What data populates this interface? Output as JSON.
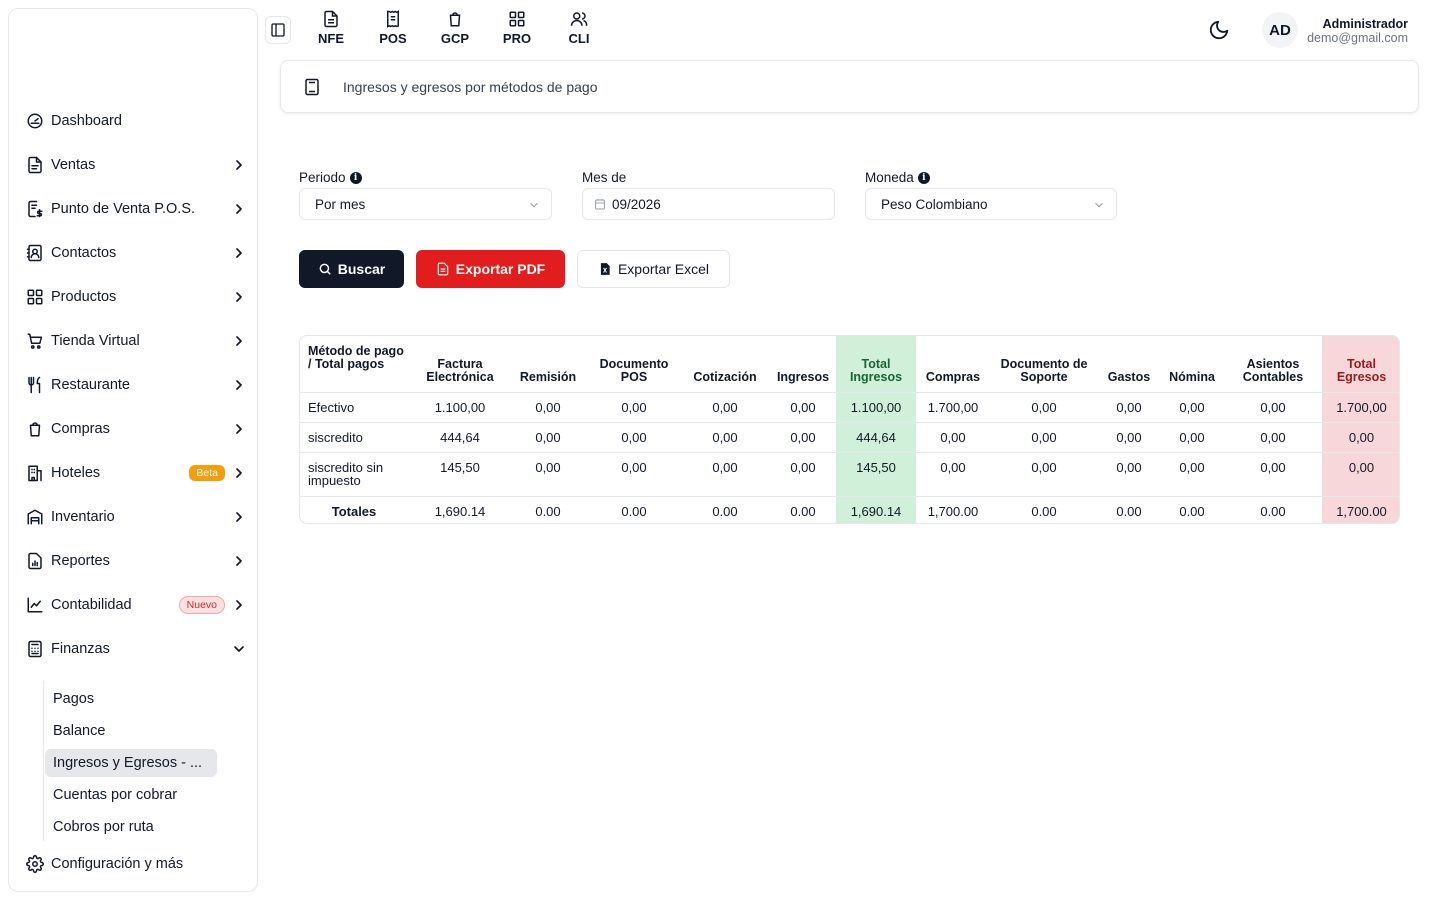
{
  "sidebar": {
    "items": [
      {
        "label": "Dashboard",
        "icon": "dashboard-icon",
        "chevron": false
      },
      {
        "label": "Ventas",
        "icon": "document-icon",
        "chevron": true
      },
      {
        "label": "Punto de Venta P.O.S.",
        "icon": "receipt-dollar-icon",
        "chevron": true
      },
      {
        "label": "Contactos",
        "icon": "contact-book-icon",
        "chevron": true
      },
      {
        "label": "Productos",
        "icon": "grid-icon",
        "chevron": true
      },
      {
        "label": "Tienda Virtual",
        "icon": "cart-icon",
        "chevron": true
      },
      {
        "label": "Restaurante",
        "icon": "utensils-icon",
        "chevron": true
      },
      {
        "label": "Compras",
        "icon": "shopping-bag-icon",
        "chevron": true
      },
      {
        "label": "Hoteles",
        "icon": "hotel-icon",
        "chevron": true,
        "badge": "Beta"
      },
      {
        "label": "Inventario",
        "icon": "warehouse-icon",
        "chevron": true
      },
      {
        "label": "Reportes",
        "icon": "report-icon",
        "chevron": true
      },
      {
        "label": "Contabilidad",
        "icon": "chart-icon",
        "chevron": true,
        "badge": "Nuevo"
      },
      {
        "label": "Finanzas",
        "icon": "calculator-icon",
        "chevron": "down"
      }
    ],
    "sub_items": [
      "Pagos",
      "Balance",
      "Ingresos y Egresos - ...",
      "Cuentas por cobrar",
      "Cobros por ruta"
    ],
    "active_sub": "Ingresos y Egresos - ...",
    "footer": "Configuración y más"
  },
  "topbar": {
    "modules": [
      "NFE",
      "POS",
      "GCP",
      "PRO",
      "CLI"
    ],
    "avatar": "AD",
    "user_name": "Administrador",
    "user_email": "demo@gmail.com"
  },
  "header": {
    "title": "Ingresos y egresos por métodos de pago"
  },
  "filters": {
    "periodo_label": "Periodo",
    "periodo_value": "Por mes",
    "mes_label": "Mes de",
    "mes_value": "09/2026",
    "moneda_label": "Moneda",
    "moneda_value": "Peso Colombiano"
  },
  "buttons": {
    "search": "Buscar",
    "pdf": "Exportar PDF",
    "excel": "Exportar Excel"
  },
  "table": {
    "headers": [
      "Método de pago / Total pagos",
      "Factura Electrónica",
      "Remisión",
      "Documento POS",
      "Cotización",
      "Ingresos",
      "Total Ingresos",
      "Compras",
      "Documento de Soporte",
      "Gastos",
      "Nómina",
      "Asientos Contables",
      "Total Egresos"
    ],
    "rows": [
      [
        "Efectivo",
        "1.100,00",
        "0,00",
        "0,00",
        "0,00",
        "0,00",
        "1.100,00",
        "1.700,00",
        "0,00",
        "0,00",
        "0,00",
        "0,00",
        "1.700,00"
      ],
      [
        "siscredito",
        "444,64",
        "0,00",
        "0,00",
        "0,00",
        "0,00",
        "444,64",
        "0,00",
        "0,00",
        "0,00",
        "0,00",
        "0,00",
        "0,00"
      ],
      [
        "siscredito sin impuesto",
        "145,50",
        "0,00",
        "0,00",
        "0,00",
        "0,00",
        "145,50",
        "0,00",
        "0,00",
        "0,00",
        "0,00",
        "0,00",
        "0,00"
      ]
    ],
    "totals": [
      "Totales",
      "1,690.14",
      "0.00",
      "0.00",
      "0.00",
      "0.00",
      "1,690.14",
      "1,700.00",
      "0.00",
      "0.00",
      "0.00",
      "0.00",
      "1,700.00"
    ]
  },
  "colors": {
    "primary_dark": "#111827",
    "pdf_red": "#e11d1d",
    "income_green_bg": "#d1f0d9",
    "expense_red_bg": "#f8d7da",
    "beta_badge": "#f59e0b"
  }
}
